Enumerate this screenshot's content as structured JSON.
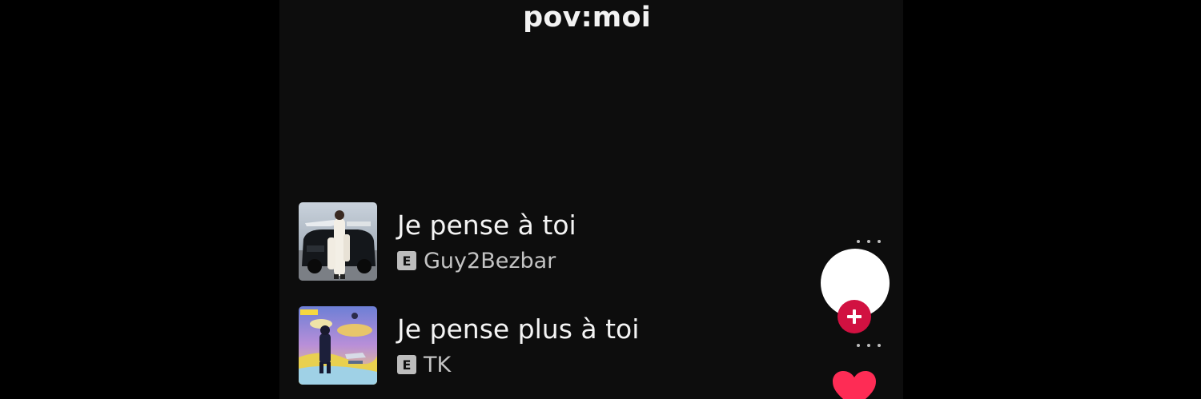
{
  "caption": "pov:moi",
  "tracks": [
    {
      "title": "Je pense à toi",
      "artist": "Guy2Bezbar",
      "explicit_label": "E"
    },
    {
      "title": "Je pense plus à toi",
      "artist": "TK",
      "explicit_label": "E"
    }
  ],
  "side_actions": {
    "avatar": "profile-avatar",
    "follow": "plus-icon",
    "like": "heart-icon"
  },
  "colors": {
    "screen": "#0d0d0d",
    "follow_button": "#d11141",
    "like_heart": "#fe2c55",
    "explicit_badge": "#bdbdbd"
  }
}
